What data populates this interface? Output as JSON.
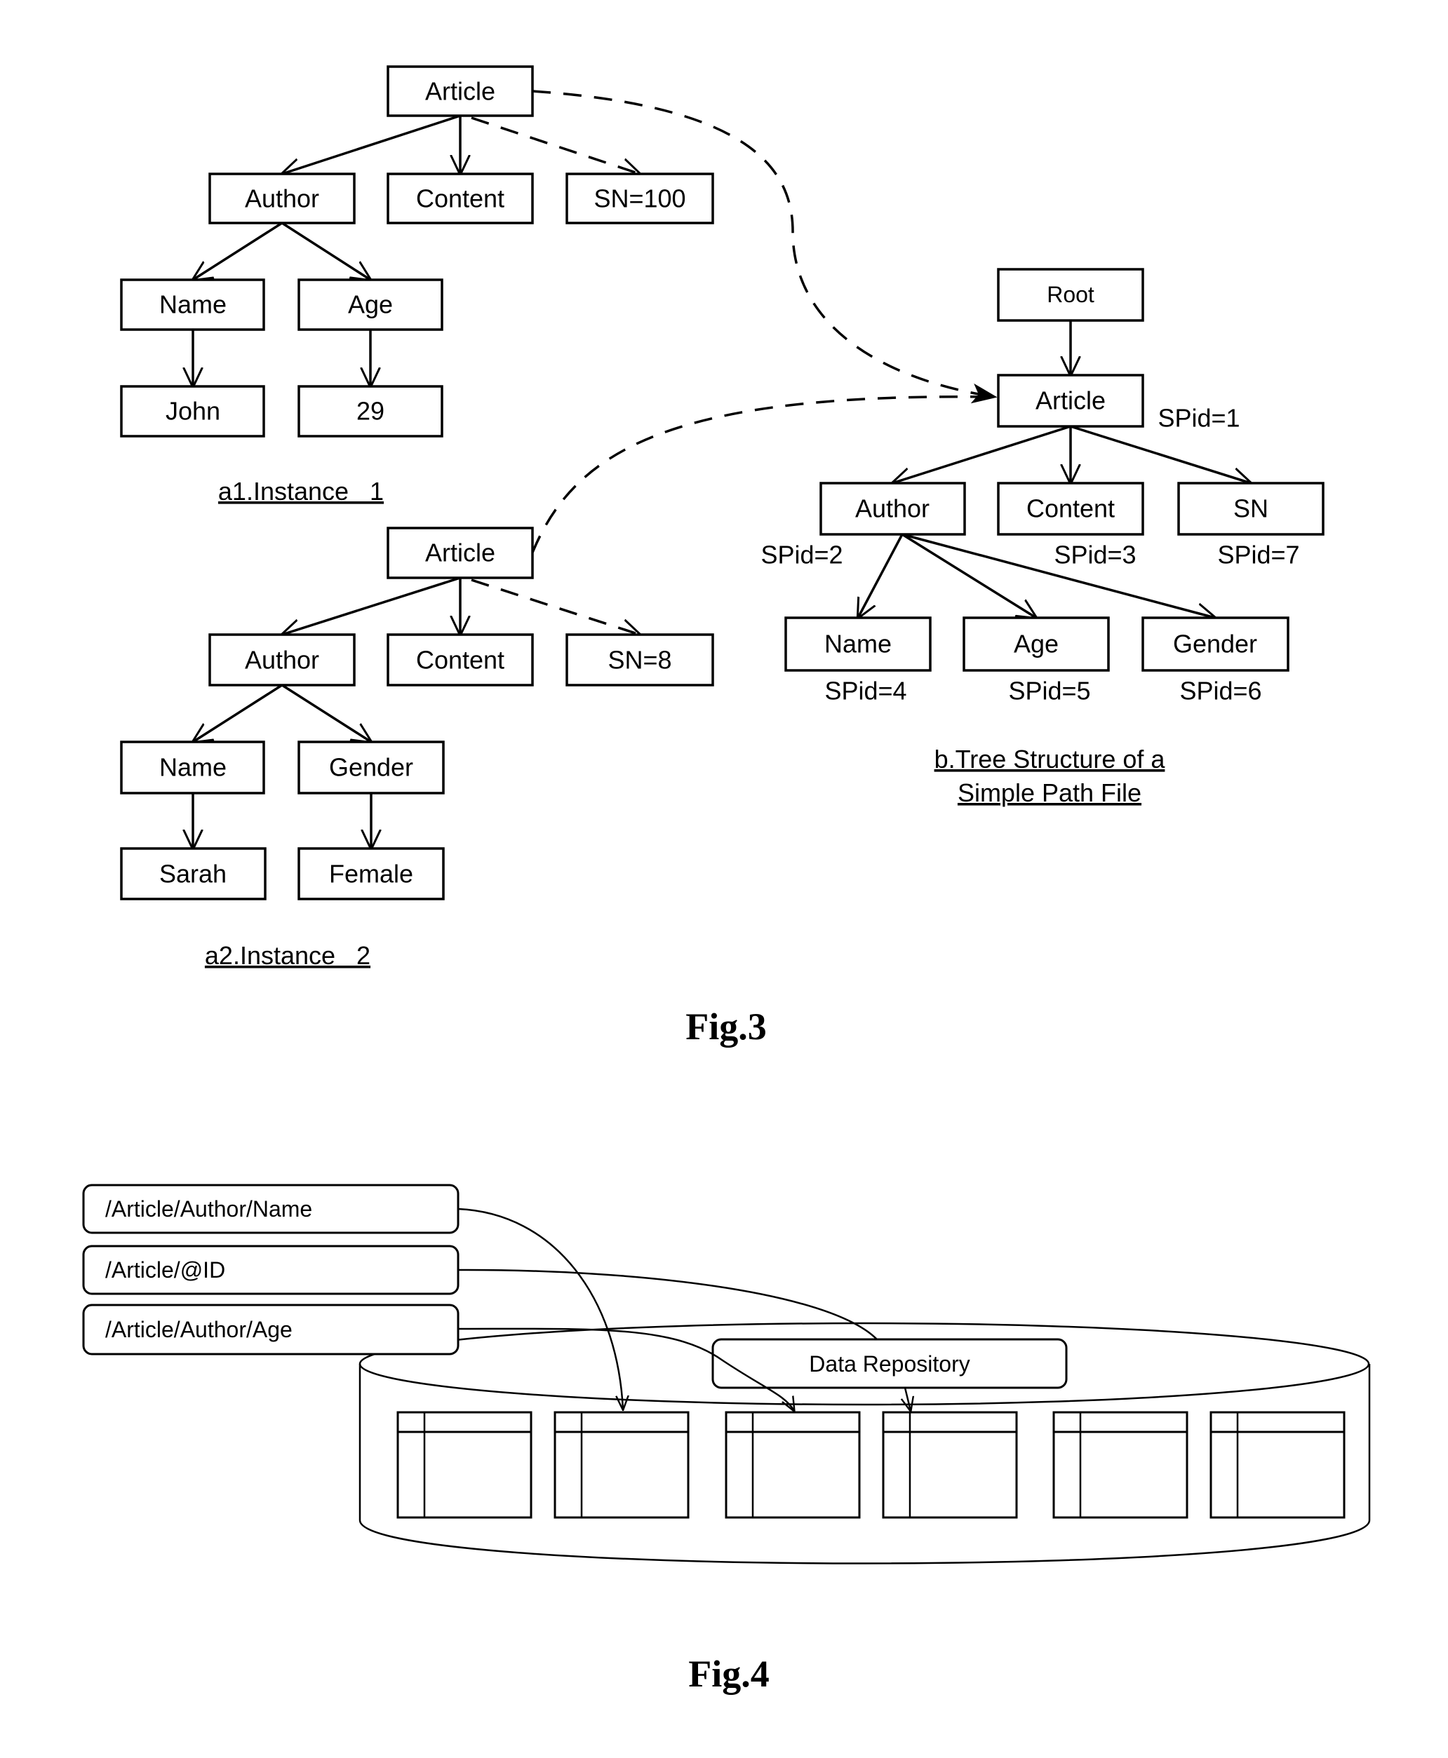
{
  "figure3": {
    "title": "Fig.3",
    "instance1": {
      "caption": "a1.Instance   1",
      "nodes": {
        "article": "Article",
        "author": "Author",
        "content": "Content",
        "sn": "SN=100",
        "name": "Name",
        "age": "Age",
        "name_value": "John",
        "age_value": "29"
      }
    },
    "instance2": {
      "caption": "a2.Instance   2",
      "nodes": {
        "article": "Article",
        "author": "Author",
        "content": "Content",
        "sn": "SN=8",
        "name": "Name",
        "gender": "Gender",
        "name_value": "Sarah",
        "gender_value": "Female"
      }
    },
    "simple_path_tree": {
      "caption_line1": "b.Tree Structure of a",
      "caption_line2": "Simple Path File",
      "nodes": {
        "root": "Root",
        "article": "Article",
        "author": "Author",
        "content": "Content",
        "sn": "SN",
        "name": "Name",
        "age": "Age",
        "gender": "Gender"
      },
      "spids": {
        "article": "SPid=1",
        "author": "SPid=2",
        "content": "SPid=3",
        "name": "SPid=4",
        "age": "SPid=5",
        "gender": "SPid=6",
        "sn": "SPid=7"
      }
    }
  },
  "figure4": {
    "title": "Fig.4",
    "paths": [
      "/Article/Author/Name",
      "/Article/@ID",
      "/Article/Author/Age"
    ],
    "repository_label": "Data Repository",
    "table_count": 6
  }
}
